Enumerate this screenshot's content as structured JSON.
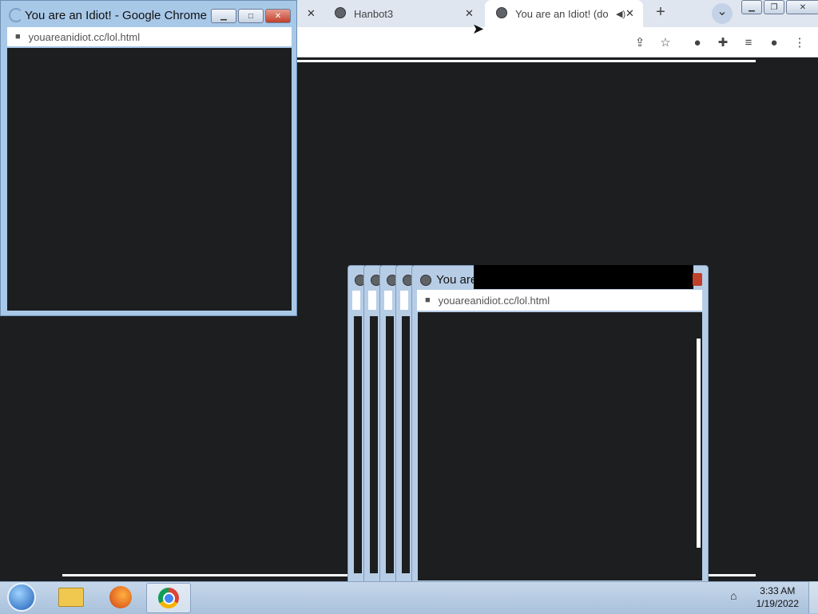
{
  "main_window": {
    "tabs": [
      {
        "label": "Hanbot3",
        "close": "✕"
      },
      {
        "label": "You are an Idiot! (do",
        "close": "✕"
      }
    ],
    "new_tab_label": "+",
    "tab_search_label": "⌄"
  },
  "popup_front": {
    "title": "You are an Idiot! - Google Chrome",
    "url": "youareanidiot.cc/lol.html"
  },
  "popup_stack": {
    "title_partial": "You are",
    "url": "youareanidiot.cc/lol.html"
  },
  "taskbar": {
    "time": "3:33 AM",
    "date": "1/19/2022"
  },
  "colors": {
    "page_background": "#1c1e20",
    "taskbar": "#b9cde3",
    "window_frame": "#a8c8e8"
  }
}
